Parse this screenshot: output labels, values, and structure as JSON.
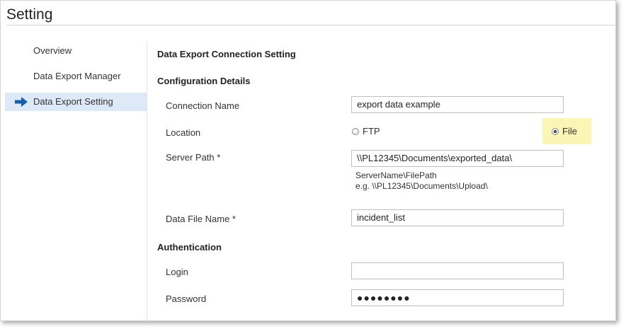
{
  "page": {
    "title": "Setting"
  },
  "sidebar": {
    "items": [
      {
        "label": "Overview"
      },
      {
        "label": "Data Export Manager"
      },
      {
        "label": "Data Export Setting",
        "active": true,
        "icon": "arrow-right-icon"
      }
    ]
  },
  "main": {
    "heading": "Data Export Connection Setting",
    "config_section": "Configuration Details",
    "connection_name": {
      "label": "Connection Name",
      "value": "export data example"
    },
    "location": {
      "label": "Location",
      "options": [
        {
          "label": "FTP",
          "selected": false
        },
        {
          "label": "File",
          "selected": true
        }
      ]
    },
    "server_path": {
      "label": "Server Path *",
      "value": "\\\\PL12345\\Documents\\exported_data\\",
      "help_line1": "ServerName\\FilePath",
      "help_line2": "e.g. \\\\PL12345\\Documents\\Upload\\"
    },
    "data_file_name": {
      "label": "Data File Name *",
      "value": "incident_list"
    },
    "auth_section": "Authentication",
    "login": {
      "label": "Login",
      "value": ""
    },
    "password": {
      "label": "Password",
      "value": "●●●●●●●●"
    }
  },
  "colors": {
    "active_bg": "#dde9f6",
    "arrow": "#1a5fa8",
    "highlight": "#fbf6b6"
  }
}
